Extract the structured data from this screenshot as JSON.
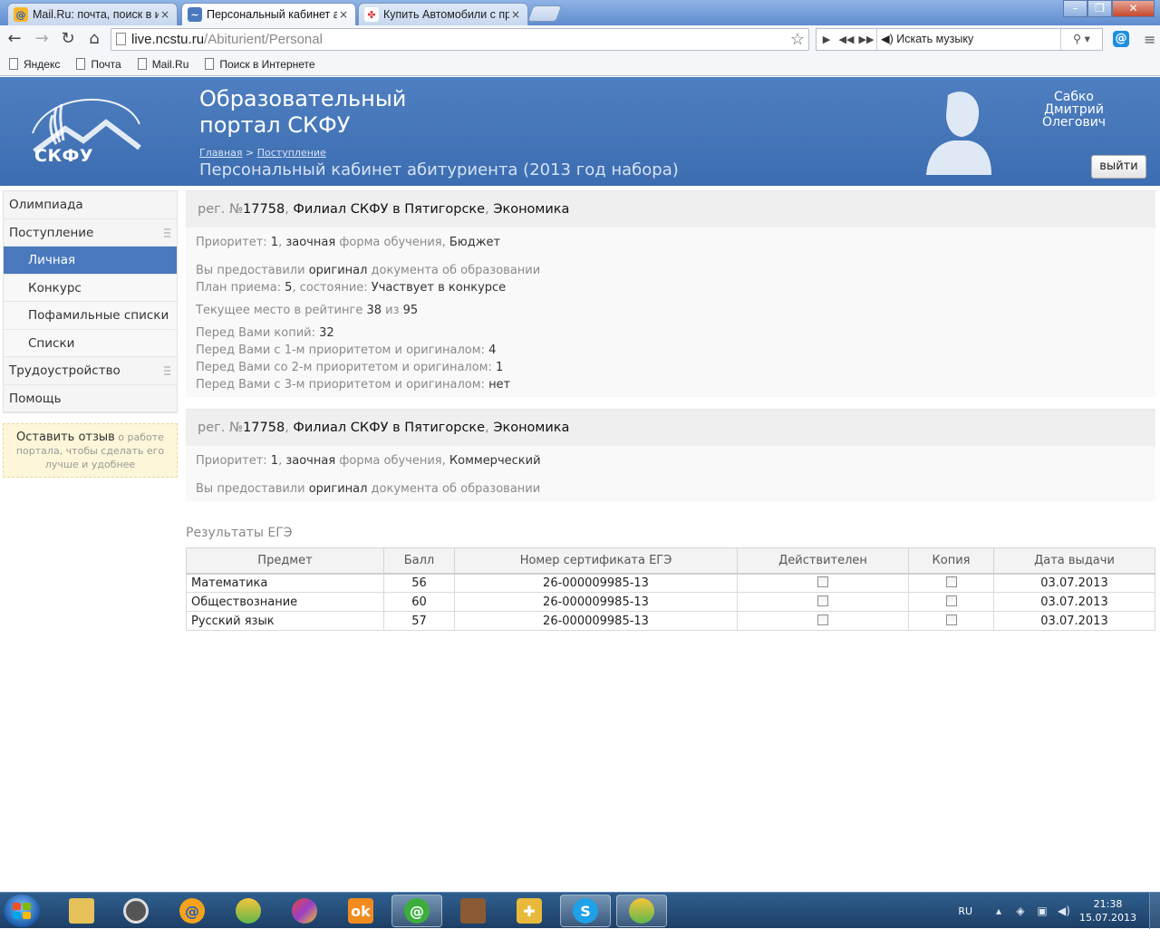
{
  "browser": {
    "tabs": [
      {
        "title": "Mail.Ru: почта, поиск в и",
        "favicon": "mailru-icon",
        "active": false
      },
      {
        "title": "Персональный кабинет а",
        "favicon": "portal-icon",
        "active": true
      },
      {
        "title": "Купить Автомобили с пр",
        "favicon": "cars-icon",
        "active": false
      }
    ],
    "close_glyph": "×",
    "url_host": "live.ncstu.ru",
    "url_path": "/Abiturient/Personal",
    "music_search_placeholder": "Искать музыку",
    "bookmarks": [
      "Яндекс",
      "Почта",
      "Mail.Ru",
      "Поиск в Интернете"
    ]
  },
  "portal": {
    "logo_text": "СКФУ",
    "title_line1": "Образовательный",
    "title_line2": "портал СКФУ",
    "breadcrumbs": [
      "Главная",
      "Поступление"
    ],
    "crumb_separator": ">",
    "heading": "Персональный кабинет абитуриента (2013 год набора)",
    "user": {
      "last": "Сабко",
      "first": "Дмитрий",
      "middle": "Олегович"
    },
    "logout_label": "выйти"
  },
  "sidebar": {
    "items": [
      {
        "label": "Олимпиада",
        "level": 0,
        "active": false,
        "grip": false
      },
      {
        "label": "Поступление",
        "level": 0,
        "active": false,
        "grip": true
      },
      {
        "label": "Личная",
        "level": 1,
        "active": true,
        "grip": false
      },
      {
        "label": "Конкурс",
        "level": 1,
        "active": false,
        "grip": false
      },
      {
        "label": "Пофамильные списки",
        "level": 1,
        "active": false,
        "grip": false
      },
      {
        "label": "Списки",
        "level": 1,
        "active": false,
        "grip": false
      },
      {
        "label": "Трудоустройство",
        "level": 0,
        "active": false,
        "grip": true
      },
      {
        "label": "Помощь",
        "level": 0,
        "active": false,
        "grip": false
      }
    ],
    "feedback": {
      "strong": "Оставить отзыв",
      "rest": " о работе портала, чтобы сделать его лучше и удобнее"
    }
  },
  "applications": [
    {
      "reg_prefix": "рег. №",
      "reg_no": "17758",
      "branch": "Филиал СКФУ в Пятигорске",
      "specialty": "Экономика",
      "priority_label": "Приоритет: ",
      "priority": "1",
      "study_form": "заочная",
      "study_form_label": " форма обучения, ",
      "funding": "Бюджет",
      "doc_label_1": "Вы предоставили ",
      "doc_type": "оригинал",
      "doc_label_2": " документа об образовании",
      "plan_label": "План приема: ",
      "plan": "5",
      "state_label": ", состояние: ",
      "state": "Участвует в конкурсе",
      "rating_label": "Текущее место в рейтинге ",
      "rating_place": "38",
      "rating_of": " из ",
      "rating_total": "95",
      "copies_label": "Перед Вами копий: ",
      "copies": "32",
      "p1_label": "Перед Вами с 1-м приоритетом и оригиналом: ",
      "p1": "4",
      "p2_label": "Перед Вами со 2-м приоритетом и оригиналом: ",
      "p2": "1",
      "p3_label": "Перед Вами с 3-м приоритетом и оригиналом: ",
      "p3": "нет"
    },
    {
      "reg_prefix": "рег. №",
      "reg_no": "17758",
      "branch": "Филиал СКФУ в Пятигорске",
      "specialty": "Экономика",
      "priority_label": "Приоритет: ",
      "priority": "1",
      "study_form": "заочная",
      "study_form_label": " форма обучения, ",
      "funding": "Коммерческий",
      "doc_label_1": "Вы предоставили ",
      "doc_type": "оригинал",
      "doc_label_2": " документа об образовании"
    }
  ],
  "ege": {
    "title": "Результаты ЕГЭ",
    "columns": [
      "Предмет",
      "Балл",
      "Номер сертификата ЕГЭ",
      "Действителен",
      "Копия",
      "Дата выдачи"
    ],
    "rows": [
      {
        "subject": "Математика",
        "score": "56",
        "cert": "26-000009985-13",
        "valid": false,
        "copy": false,
        "date": "03.07.2013"
      },
      {
        "subject": "Обществознание",
        "score": "60",
        "cert": "26-000009985-13",
        "valid": false,
        "copy": false,
        "date": "03.07.2013"
      },
      {
        "subject": "Русский язык",
        "score": "57",
        "cert": "26-000009985-13",
        "valid": false,
        "copy": false,
        "date": "03.07.2013"
      }
    ]
  },
  "taskbar": {
    "lang": "RU",
    "time": "21:38",
    "date": "15.07.2013",
    "apps": [
      "explorer-icon",
      "media-player-icon",
      "mail-agent-icon",
      "browser-icon",
      "aurora-icon",
      "odnoklassniki-icon",
      "mail-agent-icon",
      "game-avatar-icon",
      "sync-icon",
      "skype-icon",
      "browser-icon"
    ]
  },
  "colors": {
    "header": "#4a79bd",
    "active_nav": "#4a79bd",
    "feedback_bg": "#fdf6d8"
  }
}
